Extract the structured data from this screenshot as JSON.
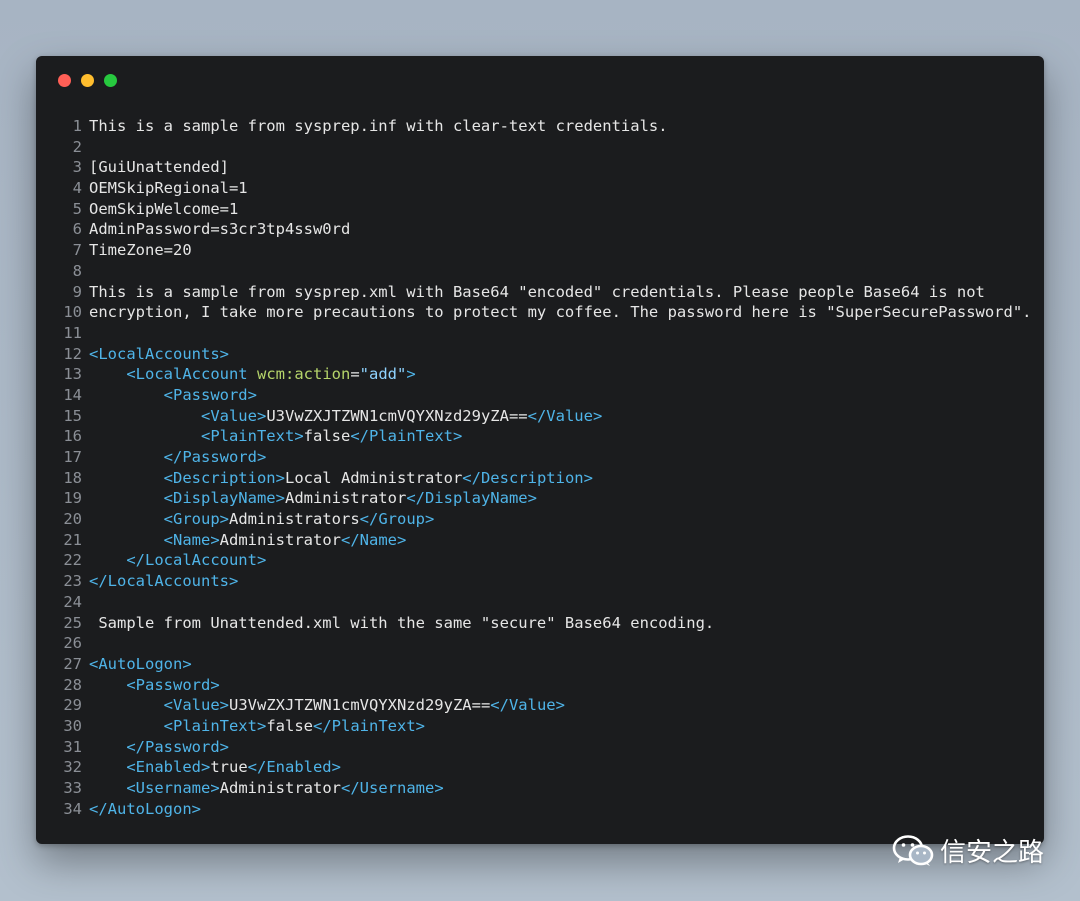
{
  "window": {
    "controls": [
      "close",
      "minimize",
      "maximize"
    ]
  },
  "code_lines": [
    {
      "n": "1",
      "t": "This is a sample from sysprep.inf with clear-text credentials."
    },
    {
      "n": "2",
      "t": ""
    },
    {
      "n": "3",
      "t": "[GuiUnattended]"
    },
    {
      "n": "4",
      "t": "OEMSkipRegional=1"
    },
    {
      "n": "5",
      "t": "OemSkipWelcome=1"
    },
    {
      "n": "6",
      "t": "AdminPassword=s3cr3tp4ssw0rd"
    },
    {
      "n": "7",
      "t": "TimeZone=20"
    },
    {
      "n": "8",
      "t": ""
    },
    {
      "n": "9",
      "t": "This is a sample from sysprep.xml with Base64 \"encoded\" credentials. Please people Base64 is not"
    },
    {
      "n": "10",
      "t": "encryption, I take more precautions to protect my coffee. The password here is \"SuperSecurePassword\"."
    },
    {
      "n": "11",
      "t": ""
    },
    {
      "n": "12",
      "t": "<LocalAccounts>"
    },
    {
      "n": "13",
      "t": "    <LocalAccount wcm:action=\"add\">"
    },
    {
      "n": "14",
      "t": "        <Password>"
    },
    {
      "n": "15",
      "t": "            <Value>U3VwZXJTZWN1cmVQYXNzd29yZA==</Value>"
    },
    {
      "n": "16",
      "t": "            <PlainText>false</PlainText>"
    },
    {
      "n": "17",
      "t": "        </Password>"
    },
    {
      "n": "18",
      "t": "        <Description>Local Administrator</Description>"
    },
    {
      "n": "19",
      "t": "        <DisplayName>Administrator</DisplayName>"
    },
    {
      "n": "20",
      "t": "        <Group>Administrators</Group>"
    },
    {
      "n": "21",
      "t": "        <Name>Administrator</Name>"
    },
    {
      "n": "22",
      "t": "    </LocalAccount>"
    },
    {
      "n": "23",
      "t": "</LocalAccounts>"
    },
    {
      "n": "24",
      "t": ""
    },
    {
      "n": "25",
      "t": " Sample from Unattended.xml with the same \"secure\" Base64 encoding."
    },
    {
      "n": "26",
      "t": ""
    },
    {
      "n": "27",
      "t": "<AutoLogon>"
    },
    {
      "n": "28",
      "t": "    <Password>"
    },
    {
      "n": "29",
      "t": "        <Value>U3VwZXJTZWN1cmVQYXNzd29yZA==</Value>"
    },
    {
      "n": "30",
      "t": "        <PlainText>false</PlainText>"
    },
    {
      "n": "31",
      "t": "    </Password>"
    },
    {
      "n": "32",
      "t": "    <Enabled>true</Enabled>"
    },
    {
      "n": "33",
      "t": "    <Username>Administrator</Username>"
    },
    {
      "n": "34",
      "t": "</AutoLogon>"
    }
  ],
  "syntax_lines": [
    12,
    13,
    14,
    15,
    16,
    17,
    18,
    19,
    20,
    21,
    22,
    23,
    27,
    28,
    29,
    30,
    31,
    32,
    33,
    34
  ],
  "colors": {
    "window_bg": "#1b1c1e",
    "text": "#e6e6e6",
    "line_number": "#8b8f96",
    "tag": "#4fb4e8",
    "attribute": "#b5d46a",
    "string": "#8fd3ff"
  },
  "watermark": {
    "text": "信安之路",
    "icon": "wechat-icon"
  }
}
